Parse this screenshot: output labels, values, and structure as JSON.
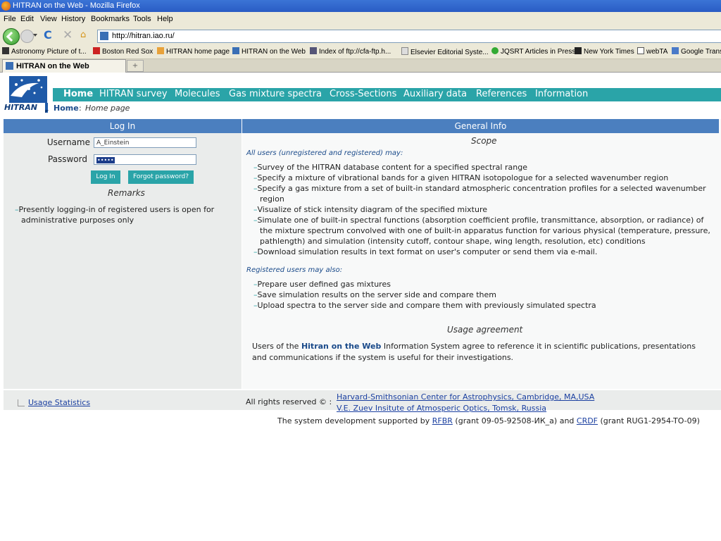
{
  "window": {
    "title": "HITRAN on the Web - Mozilla Firefox"
  },
  "menu": [
    "File",
    "Edit",
    "View",
    "History",
    "Bookmarks",
    "Tools",
    "Help"
  ],
  "address": {
    "url": "http://hitran.iao.ru/"
  },
  "bookmarks": [
    "Astronomy Picture of t...",
    "Boston Red Sox",
    "HITRAN home page",
    "HITRAN on the Web",
    "Index of ftp://cfa-ftp.h...",
    "Elsevier Editorial Syste...",
    "JQSRT Articles in Press",
    "New York Times",
    "webTA",
    "Google Trans"
  ],
  "tab": {
    "title": "HITRAN on the Web",
    "new_tab": "+"
  },
  "site": {
    "logo_text": "HITRAN",
    "nav": [
      "Home",
      "HITRAN survey",
      "Molecules",
      "Gas mixture spectra",
      "Cross-Sections",
      "Auxiliary data",
      "References",
      "Information"
    ],
    "breadcrumb": {
      "home": "Home",
      "sep": ":",
      "page": "Home page"
    }
  },
  "login": {
    "heading": "Log In",
    "username_label": "Username",
    "username_value": "A_Einstein",
    "password_label": "Password",
    "password_value": "•••••",
    "login_button": "Log In",
    "forgot_button": "Forgot password?",
    "remarks_title": "Remarks",
    "remark": "Presently logging-in of registered users is open for administrative purposes only"
  },
  "info": {
    "heading": "General Info",
    "scope_title": "Scope",
    "all_users_title": "All users (unregistered and registered) may:",
    "all_users_items": [
      "Survey of the HITRAN database content for a specified spectral range",
      "Specify a mixture of vibrational bands for a given HITRAN isotopologue for a selected wavenumber region",
      "Specify a gas mixture from a set of built-in standard atmospheric concentration profiles for a selected wavenumber region",
      "Visualize of stick intensity diagram of the specified mixture",
      "Simulate one of built-in spectral functions (absorption coefficient profile, transmittance, absorption, or radiance) of the mixture spectrum convolved with one of built-in apparatus function for various physical (temperature, pressure, pathlength) and simulation (intensity cutoff, contour shape, wing length, resolution, etc) conditions",
      "Download simulation results in text format on user's computer or send them via e-mail."
    ],
    "registered_title": "Registered users may also:",
    "registered_items": [
      "Prepare user defined gas mixtures",
      "Save simulation results on the server side and compare them",
      "Upload spectra to the server side and compare them with previously simulated spectra"
    ],
    "usage_title": "Usage agreement",
    "usage_pre": "Users of the ",
    "usage_bold": "Hitran on the Web",
    "usage_post": " Information System agree to reference it in scientific publications, presentations and communications if the system is useful for their investigations."
  },
  "footer": {
    "stats_link": "Usage Statistics",
    "rights": "All rights reserved © :",
    "org1": "Harvard-Smithsonian Center for Astrophysics, Cambridge, MA,USA",
    "org2": "V.E. Zuev Insitute of Atmosperic Optics, Tomsk, Russia",
    "support_pre": "The system development supported by ",
    "rfbr": "RFBR",
    "support_mid": " (grant 09-05-92508-ИК_a) and ",
    "crdf": "CRDF",
    "support_post": " (grant RUG1-2954-TO-09)"
  }
}
